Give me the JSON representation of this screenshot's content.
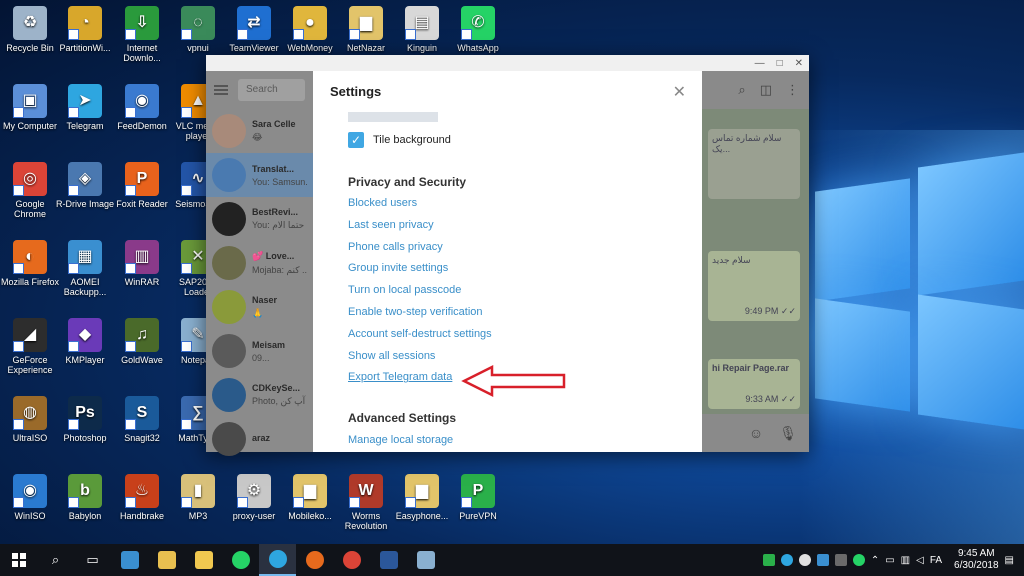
{
  "desktop_icons": [
    {
      "label": "Recycle Bin",
      "color": "#9db3c9",
      "glyph": "♻"
    },
    {
      "label": "PartitionWi...",
      "color": "#d8a72b",
      "glyph": "◔"
    },
    {
      "label": "Internet Downlo...",
      "color": "#2a9a3c",
      "glyph": "⇩"
    },
    {
      "label": "vpnui",
      "color": "#3a8a5a",
      "glyph": "◌"
    },
    {
      "label": "TeamViewer",
      "color": "#1f6fd1",
      "glyph": "⇄"
    },
    {
      "label": "WebMoney",
      "color": "#e0b63c",
      "glyph": "●"
    },
    {
      "label": "NetNazar",
      "color": "#e2c46a",
      "glyph": "▆"
    },
    {
      "label": "Kinguin",
      "color": "#d8d8d8",
      "glyph": "▤"
    },
    {
      "label": "WhatsApp",
      "color": "#25d366",
      "glyph": "✆"
    },
    {
      "label": "My Computer",
      "color": "#5b8fd8",
      "glyph": "▣"
    },
    {
      "label": "Telegram",
      "color": "#2ea6e0",
      "glyph": "➤"
    },
    {
      "label": "FeedDemon",
      "color": "#3a7ad0",
      "glyph": "◉"
    },
    {
      "label": "VLC media player",
      "color": "#f08c00",
      "glyph": "▲"
    },
    {
      "label": "Google Chrome",
      "color": "#db4437",
      "glyph": "◎"
    },
    {
      "label": "R-Drive Image",
      "color": "#4a78b0",
      "glyph": "◈"
    },
    {
      "label": "Foxit Reader",
      "color": "#e8621c",
      "glyph": "P"
    },
    {
      "label": "SeismoSi...",
      "color": "#2355a8",
      "glyph": "∿"
    },
    {
      "label": "Mozilla Firefox",
      "color": "#e66a1d",
      "glyph": "◐"
    },
    {
      "label": "AOMEI Backupp...",
      "color": "#3a8fd0",
      "glyph": "▦"
    },
    {
      "label": "WinRAR",
      "color": "#8a3a8a",
      "glyph": "▥"
    },
    {
      "label": "SAP2000 Loader",
      "color": "#6a9a3a",
      "glyph": "✕"
    },
    {
      "label": "GeForce Experience",
      "color": "#2d2d2d",
      "glyph": "◢"
    },
    {
      "label": "KMPlayer",
      "color": "#6a3ab8",
      "glyph": "◆"
    },
    {
      "label": "GoldWave",
      "color": "#4a6a2a",
      "glyph": "♫"
    },
    {
      "label": "Notepad",
      "color": "#8ab0d0",
      "glyph": "✎"
    },
    {
      "label": "UltraISO",
      "color": "#9a6a2a",
      "glyph": "◍"
    },
    {
      "label": "Photoshop",
      "color": "#0d2a4a",
      "glyph": "Ps"
    },
    {
      "label": "Snagit32",
      "color": "#1a5a9a",
      "glyph": "S"
    },
    {
      "label": "MathType",
      "color": "#3a6ab0",
      "glyph": "∑"
    },
    {
      "label": "WinISO",
      "color": "#2a7ad0",
      "glyph": "◉"
    },
    {
      "label": "Babylon",
      "color": "#5a9a3a",
      "glyph": "b"
    },
    {
      "label": "Handbrake",
      "color": "#c8401a",
      "glyph": "♨"
    },
    {
      "label": "MP3",
      "color": "#d8c07a",
      "glyph": "▮"
    },
    {
      "label": "proxy-user",
      "color": "#c8c8c8",
      "glyph": "⚙"
    },
    {
      "label": "Mobileko...",
      "color": "#e2c46a",
      "glyph": "▆"
    },
    {
      "label": "Worms Revolution",
      "color": "#b03a2a",
      "glyph": "W"
    },
    {
      "label": "Easyphone...",
      "color": "#e2c46a",
      "glyph": "▆"
    },
    {
      "label": "PureVPN",
      "color": "#2ab04a",
      "glyph": "P"
    }
  ],
  "window": {
    "controls": [
      "—",
      "□",
      "✕"
    ]
  },
  "chat_list": {
    "search_placeholder": "Search",
    "chats": [
      {
        "name": "Sara Celle",
        "preview": "😂",
        "avatar_color": "#a88a7a",
        "active": false
      },
      {
        "name": "Translat...",
        "preview": "You: Samsun...",
        "avatar_color": "#4a7ab0",
        "active": true
      },
      {
        "name": "BestRevi...",
        "preview": "You: حتما الام",
        "avatar_color": "#222222",
        "active": false
      },
      {
        "name": "💕 Love...",
        "preview": "Mojaba: کنم ...",
        "avatar_color": "#6a6a4a",
        "active": false
      },
      {
        "name": "Naser",
        "preview": "🙏",
        "avatar_color": "#8a9a3a",
        "active": false
      },
      {
        "name": "Meisam",
        "preview": "09...",
        "avatar_color": "#5a5a5a",
        "active": false
      },
      {
        "name": "CDKeySe...",
        "preview": "Photo, بک آپ کن",
        "avatar_color": "#2a5a8a",
        "active": false
      },
      {
        "name": "araz",
        "preview": "",
        "avatar_color": "#4a4a4a",
        "active": false
      }
    ]
  },
  "chat_pane": {
    "messages": [
      {
        "text": "سلام شماره تماس یک...",
        "time": ""
      },
      {
        "text": "سلام جدید",
        "time": "9:49 PM ✓✓"
      },
      {
        "text": "hi Repair Page.rar",
        "time": "9:33 AM ✓✓"
      }
    ]
  },
  "settings": {
    "title": "Settings",
    "tile_background": "Tile background",
    "privacy_title": "Privacy and Security",
    "privacy_links": [
      "Blocked users",
      "Last seen privacy",
      "Phone calls privacy",
      "Group invite settings",
      "Turn on local passcode",
      "Enable two-step verification",
      "Account self-destruct settings",
      "Show all sessions",
      "Export Telegram data"
    ],
    "advanced_title": "Advanced Settings",
    "advanced_links": [
      "Manage local storage"
    ],
    "highlight_color": "#d8202a"
  },
  "taskbar": {
    "time": "9:45 AM",
    "date": "6/30/2018",
    "lang": "FA"
  }
}
